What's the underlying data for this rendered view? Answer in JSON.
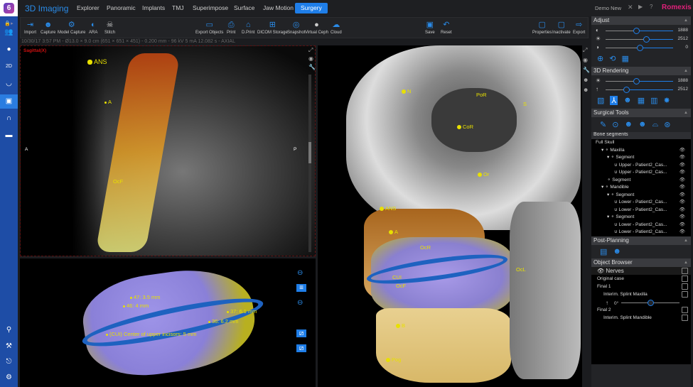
{
  "app": {
    "title": "3D Imaging",
    "brand": "Romexis",
    "user": "Demo New",
    "logo_text": "6"
  },
  "tabs": [
    "Explorer",
    "Panoramic",
    "Implants",
    "TMJ",
    "Superimpose",
    "Surface",
    "Jaw Motion",
    "Surgery"
  ],
  "active_tab": "Surgery",
  "toolbar": {
    "left": [
      "Import",
      "Capture",
      "Model Capture",
      "ARA",
      "Stitch"
    ],
    "middle": [
      "Export Objects",
      "Print",
      "D.Print",
      "DICOM Storage",
      "Snapshot",
      "Virtual Ceph",
      "Cloud"
    ],
    "save": [
      "Save",
      "Reset"
    ],
    "right": [
      "Properties",
      "Inactivate",
      "Export"
    ]
  },
  "info_line": "10/30/17 3:57 PM - Ø13.0 × 9.0 cm (651 × 651 × 451) - 0.200 mm - 96 kV 5 mA 12.082 s - AXIAL",
  "sagittal": {
    "label": "Sagittal(X)",
    "left_marker": "A",
    "right_marker": "P",
    "landmarks": [
      "ANS",
      "A",
      "OcF"
    ]
  },
  "dental": {
    "measurements": [
      "47: 3.5 mm",
      "46: 4 mm",
      "37: 6.1 mm",
      "36: 6.2 mm",
      "(CUI) Center of upper incisors: 5 mm"
    ]
  },
  "skull": {
    "landmarks": [
      "N",
      "PoR",
      "S",
      "CoR",
      "Or",
      "ANS",
      "A",
      "OcR",
      "OcL",
      "CUI",
      "OcF",
      "B",
      "Pog"
    ]
  },
  "panel": {
    "adjust": {
      "title": "Adjust",
      "sliders": [
        {
          "value": "1888",
          "fraction": 0.45
        },
        {
          "value": "2512",
          "fraction": 0.6
        },
        {
          "value": "0",
          "fraction": 0.5
        }
      ]
    },
    "rendering": {
      "title": "3D Rendering",
      "sliders": [
        {
          "value": "1888",
          "fraction": 0.45
        },
        {
          "value": "2512",
          "fraction": 0.3
        }
      ]
    },
    "surgical": {
      "title": "Surgical Tools",
      "bone_title": "Bone segments",
      "tree": [
        "Full Skull",
        "Maxilla",
        "Segment",
        "Upper - Patient2_Cas...",
        "Upper - Patient2_Cas...",
        "Segment",
        "Mandible",
        "Segment",
        "Lower - Patient2_Cas...",
        "Lower - Patient2_Cas...",
        "Segment",
        "Lower - Patient2_Cas...",
        "Lower - Patient2_Cas..."
      ]
    },
    "post": {
      "title": "Post-Planning"
    },
    "objects": {
      "title": "Object Browser",
      "items": [
        "Nerves",
        "Original case",
        "Final 1",
        "Interim. Splint Maxilla",
        "Final 2",
        "Interim. Splint Mandible"
      ],
      "angle": "0°",
      "angle_fraction": 0.5
    }
  },
  "colors": {
    "accent": "#1f7ee8",
    "brand": "#e0207a",
    "landmark": "#e8e000",
    "sidebar": "#1e4da6"
  }
}
